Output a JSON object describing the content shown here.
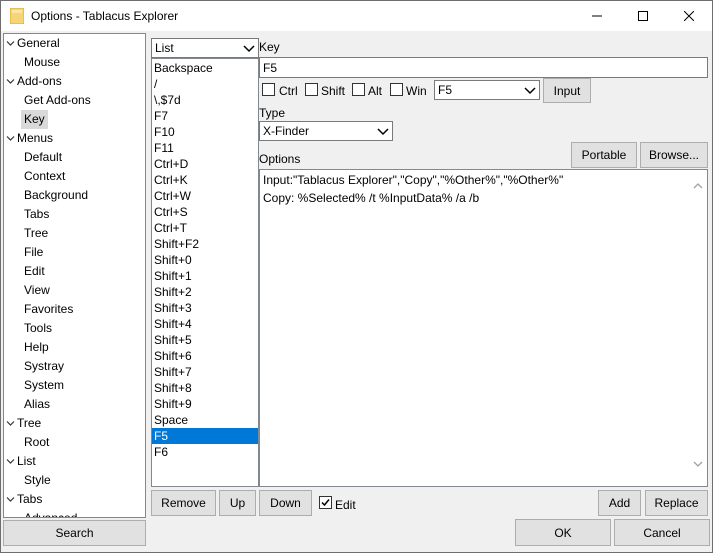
{
  "window": {
    "title": "Options - Tablacus Explorer"
  },
  "tree": {
    "items": [
      {
        "label": "General",
        "level": 0,
        "expanded": true
      },
      {
        "label": "Mouse",
        "level": 1
      },
      {
        "label": "Add-ons",
        "level": 0,
        "expanded": true
      },
      {
        "label": "Get Add-ons",
        "level": 1
      },
      {
        "label": "Key",
        "level": 1,
        "selected": true
      },
      {
        "label": "Menus",
        "level": 0,
        "expanded": true
      },
      {
        "label": "Default",
        "level": 1
      },
      {
        "label": "Context",
        "level": 1
      },
      {
        "label": "Background",
        "level": 1
      },
      {
        "label": "Tabs",
        "level": 1
      },
      {
        "label": "Tree",
        "level": 1
      },
      {
        "label": "File",
        "level": 1
      },
      {
        "label": "Edit",
        "level": 1
      },
      {
        "label": "View",
        "level": 1
      },
      {
        "label": "Favorites",
        "level": 1
      },
      {
        "label": "Tools",
        "level": 1
      },
      {
        "label": "Help",
        "level": 1
      },
      {
        "label": "Systray",
        "level": 1
      },
      {
        "label": "System",
        "level": 1
      },
      {
        "label": "Alias",
        "level": 1
      },
      {
        "label": "Tree",
        "level": 0,
        "expanded": true
      },
      {
        "label": "Root",
        "level": 1
      },
      {
        "label": "List",
        "level": 0,
        "expanded": true
      },
      {
        "label": "Style",
        "level": 1
      },
      {
        "label": "Tabs",
        "level": 0,
        "expanded": true
      },
      {
        "label": "Advanced",
        "level": 1
      }
    ],
    "search_label": "Search"
  },
  "keylist": {
    "mode": "List",
    "items": [
      "Backspace",
      "/",
      "\\,$7d",
      "F7",
      "F10",
      "F11",
      "Ctrl+D",
      "Ctrl+K",
      "Ctrl+W",
      "Ctrl+S",
      "Ctrl+T",
      "Shift+F2",
      "Shift+0",
      "Shift+1",
      "Shift+2",
      "Shift+3",
      "Shift+4",
      "Shift+5",
      "Shift+6",
      "Shift+7",
      "Shift+8",
      "Shift+9",
      "Space",
      "F5",
      "F6"
    ],
    "selected_index": 23
  },
  "key": {
    "label": "Key",
    "value": "F5",
    "modifiers": [
      {
        "label": "Ctrl",
        "checked": false
      },
      {
        "label": "Shift",
        "checked": false
      },
      {
        "label": "Alt",
        "checked": false
      },
      {
        "label": "Win",
        "checked": false
      }
    ],
    "key_select": "F5",
    "input_label": "Input"
  },
  "type": {
    "label": "Type",
    "value": "X-Finder"
  },
  "options": {
    "label": "Options",
    "portable_label": "Portable",
    "browse_label": "Browse...",
    "lines": [
      "Input:\"Tablacus Explorer\",\"Copy\",\"%Other%\",\"%Other%\"",
      "Copy: %Selected% /t %InputData% /a /b"
    ]
  },
  "actions": {
    "remove": "Remove",
    "up": "Up",
    "down": "Down",
    "edit": "Edit",
    "edit_checked": true,
    "add": "Add",
    "replace": "Replace",
    "ok": "OK",
    "cancel": "Cancel"
  },
  "colors": {
    "selection": "#0078d7",
    "tree_selection": "#d9d9d9",
    "button_face": "#e1e1e1",
    "window_bg": "#f0f0f0"
  }
}
